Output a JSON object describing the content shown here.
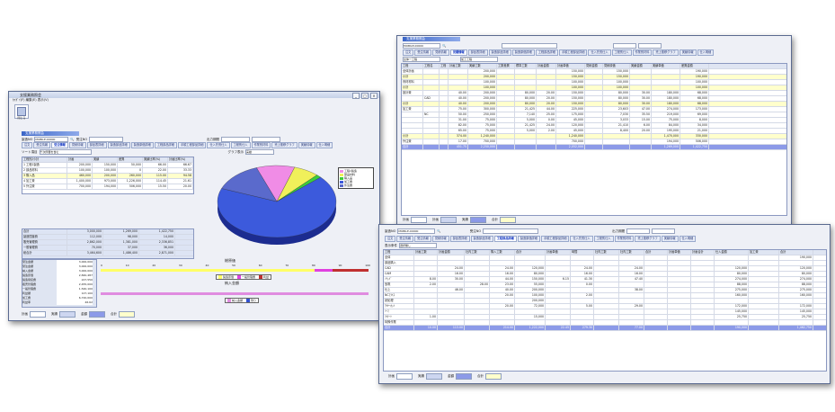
{
  "w1": {
    "title": "支援業務照会",
    "menu": [
      "ｶｲｶﾞｲ(F)",
      "編集(E)",
      "表示(V)"
    ],
    "tool_label": "閉じる",
    "header": "支援業務照会",
    "code_label": "製造NO",
    "code_value": "MOBILE-00000",
    "shop_label": "受注NO",
    "period_label": "出力期間",
    "tabs": [
      "注文",
      "受注情報",
      "受注情報",
      "見積情報",
      "部品表詳細",
      "製造部品詳細",
      "製造原価詳細",
      "工程部品詳細",
      "手順工程部品詳細",
      "仕入先別仕入",
      "工程別仕入",
      "作業別材料",
      "売上推移グラフ",
      "実績情報",
      "仕入明細"
    ],
    "filter_label": "ソート項目",
    "filter_value": "千次所要を含む",
    "sub_label": "グラフ表示",
    "sub_value": "実績",
    "table_headers": [
      "工程別/小計",
      "計画",
      "実績",
      "差異",
      "実績比率(%)",
      "計画比率(%)"
    ],
    "rows": [
      [
        "1 工程1製造",
        "200,000",
        "150,000",
        "50,000",
        "66.00",
        "66.67"
      ],
      [
        "2 部品材料",
        "100,000",
        "100,000",
        "0",
        "22.00",
        "33.33"
      ],
      [
        "3 購入品",
        "460,000",
        "200,000",
        "260,000",
        "115.00",
        "94.58"
      ],
      [
        "4 加工費",
        "1,400,000",
        "973,000",
        "1,226,000",
        "114.45",
        "21.61"
      ],
      [
        "5 外注費",
        "700,000",
        "194,000",
        "506,000",
        "15.50",
        "20.00"
      ]
    ],
    "summary_rows": [
      [
        "合計",
        "3,000,000",
        "1,269,000",
        "1,422,750"
      ],
      [
        "製造間接費",
        "112,000",
        "98,000",
        "14,000"
      ],
      [
        "販売管理費",
        "2,862,000",
        "1,381,000",
        "2,336,851"
      ],
      [
        "一般管理費",
        "70,000",
        "37,000",
        "36,000"
      ],
      [
        "総合計",
        "3,464,600",
        "1,486,400",
        "2,871,000"
      ]
    ],
    "legend": [
      "工程1製造",
      "部品材料",
      "購入品",
      "加工費",
      "外注費"
    ],
    "pie_colors": [
      "#f08ce6",
      "#f0f05a",
      "#3ccc3c",
      "#3c5adc",
      "#5a6acc"
    ],
    "pie_values": [
      150000,
      100000,
      20000,
      973000,
      194000
    ],
    "progress_labels": [
      "受注金額",
      "受注金額",
      "納入金額",
      "製造原価",
      "製造間接費",
      "販売管理費",
      "一般管理費",
      "利益額",
      "加工費",
      "利益率"
    ],
    "progress_values": [
      "3,000,000",
      "3,000,000",
      "3,000,000",
      "2,840,487",
      "227,550",
      "2,455,000",
      "1,540,100",
      "127,100",
      "6,720,000",
      "46.62"
    ],
    "chart1_title": "総原価",
    "chart1_legend": [
      "製造原価",
      "一般管理費",
      "利益"
    ],
    "chart2_title": "納入金額",
    "chart2_legend": [
      "納入金額",
      "残り"
    ],
    "axis": [
      "0",
      "10",
      "20",
      "30",
      "40",
      "50",
      "60",
      "70",
      "80",
      "90",
      "100"
    ],
    "buttons": [
      "計画",
      "実績",
      "金額",
      "合計"
    ]
  },
  "w2": {
    "title": "支援業務照会",
    "header": "支援業務照会",
    "code_value": "MOBILE-00000",
    "tabs": [
      "注文",
      "受注情報",
      "見積情報",
      "見積情報",
      "部品表詳細",
      "製造部品詳細",
      "製造原価詳細",
      "工程部品詳細",
      "手順工程部品詳細",
      "仕入先別仕入",
      "工程別仕入",
      "作業別材料",
      "売上推移グラフ",
      "実績情報",
      "仕入明細"
    ],
    "filter_value": "全体一工程",
    "filter2_value": "加工工程",
    "headers": [
      "工程",
      "工程名",
      "工程",
      "計画工数",
      "実績工数",
      "工数差異",
      "標準工数",
      "計画金額",
      "計画単価",
      "見積金額",
      "見積原価",
      "実績金額",
      "実績単価",
      "差異金額"
    ],
    "rows": [
      [
        "全体計画",
        "",
        "",
        "",
        "200,000",
        "",
        "",
        "",
        "150,000",
        "",
        "150,000",
        "",
        "",
        "190,000"
      ],
      [
        "小計",
        "",
        "",
        "",
        "200,000",
        "",
        "",
        "",
        "150,000",
        "",
        "150,000",
        "",
        "",
        "190,000"
      ],
      [
        "資材材料",
        "",
        "",
        "",
        "100,000",
        "",
        "",
        "",
        "100,000",
        "",
        "100,000",
        "",
        "",
        "100,000"
      ],
      [
        "小計",
        "",
        "",
        "",
        "100,000",
        "",
        "",
        "",
        "100,000",
        "",
        "100,000",
        "",
        "",
        "100,000"
      ],
      [
        "設計費",
        "",
        "",
        "40.00",
        "200,000",
        "",
        "80,000",
        "20.00",
        "150,000",
        "",
        "80,000",
        "30.00",
        "180,000",
        "68,000"
      ],
      [
        "",
        "CAD",
        "",
        "40.00",
        "200,000",
        "",
        "80,000",
        "20.00",
        "150,000",
        "",
        "80,000",
        "30.00",
        "180,000",
        "68,000"
      ],
      [
        "小計",
        "",
        "",
        "40.00",
        "200,000",
        "",
        "80,000",
        "20.00",
        "150,000",
        "",
        "80,000",
        "30.00",
        "180,000",
        "68,000"
      ],
      [
        "加工費",
        "",
        "",
        "75.00",
        "300,000",
        "",
        "21,425",
        "44.00",
        "225,000",
        "",
        "23,603",
        "47.00",
        "274,000",
        "173,000"
      ],
      [
        "",
        "NC",
        "",
        "50.00",
        "250,000",
        "",
        "7,140",
        "25.00",
        "175,000",
        "",
        "7,030",
        "35.50",
        "219,000",
        "69,000"
      ],
      [
        "",
        "",
        "",
        "31.00",
        "75,000",
        "",
        "5,000",
        "0.00",
        "45,000",
        "",
        "3,033",
        "15.00",
        "75,000",
        "8,000"
      ],
      [
        "",
        "",
        "",
        "82.00",
        "75,000",
        "",
        "21,425",
        "24.00",
        "120,000",
        "",
        "21,410",
        "6.00",
        "84,000",
        "34,000"
      ],
      [
        "",
        "",
        "",
        "65.00",
        "75,000",
        "",
        "5,000",
        "2.00",
        "45,000",
        "",
        "8,400",
        "20.00",
        "195,000",
        "21,000"
      ],
      [
        "小計",
        "",
        "",
        "374.00",
        "1,240,000",
        "",
        "",
        "",
        "1,240,000",
        "",
        "",
        "",
        "1,470,000",
        "330,000"
      ],
      [
        "外注費",
        "",
        "",
        "17.00",
        "700,000",
        "",
        "",
        "",
        "700,000",
        "",
        "",
        "",
        "194,000",
        "506,000"
      ],
      [
        "合計",
        "",
        "",
        "451.75",
        "2,250,000",
        "",
        "",
        "",
        "2,052,000",
        "",
        "",
        "",
        "1,269,000",
        "1,422,750"
      ]
    ],
    "buttons": [
      "計画",
      "計画",
      "実績",
      "合計"
    ]
  },
  "w3": {
    "header_code": "製造NO",
    "code_value": "MOBILE-00000",
    "shop_label": "受注NO",
    "period_label": "出力期間",
    "tabs": [
      "注文",
      "受注情報",
      "受注情報",
      "見積情報",
      "部品表詳細",
      "製造部品詳細",
      "工程部品詳細",
      "製造原価詳細",
      "手順工程部品詳細",
      "仕入先別仕入",
      "工程別仕入",
      "作業別材料",
      "売上推移グラフ",
      "実績情報",
      "仕入明細"
    ],
    "filter_label": "表示条件",
    "filter_value": "選択無し",
    "headers": [
      "工程",
      "計画工数",
      "計画金額",
      "社内工数",
      "購入工数",
      "合計",
      "計画単価",
      "時間",
      "社内工数",
      "社内工数",
      "合計",
      "計画単価",
      "計画合計",
      "仕入金額",
      "加工費",
      "合計"
    ],
    "rows": [
      [
        "全体",
        "",
        "",
        "",
        "",
        "",
        "",
        "",
        "",
        "",
        "",
        "",
        "",
        "",
        "",
        "190,000"
      ],
      [
        "部品購入",
        "",
        "",
        "",
        "",
        "",
        "",
        "",
        "",
        "",
        "",
        "",
        "",
        "",
        "",
        ""
      ],
      [
        "CAD",
        "",
        "24.00",
        "",
        "24.00",
        "120,000",
        "",
        "24.00",
        "",
        "24.00",
        "",
        "",
        "",
        "120,000",
        "",
        "120,000"
      ],
      [
        "CAM",
        "",
        "16.00",
        "",
        "16.00",
        "80,000",
        "",
        "16.00",
        "",
        "16.00",
        "",
        "",
        "",
        "80,000",
        "",
        "80,000"
      ],
      [
        "ｿﾘｯﾄﾞ",
        "8.00",
        "30.00",
        "",
        "44.00",
        "150,000",
        "6.15",
        "41.30",
        "",
        "47.40",
        "",
        "",
        "",
        "274,000",
        "",
        "274,000"
      ],
      [
        "放電",
        "2.00",
        "",
        "28.00",
        "23.00",
        "55,000",
        "",
        "0.00",
        "",
        "",
        "",
        "",
        "",
        "88,000",
        "",
        "88,000"
      ],
      [
        "仕上",
        "",
        "46.00",
        "",
        "40.00",
        "200,000",
        "",
        "",
        "",
        "38.00",
        "",
        "",
        "",
        "275,000",
        "",
        "275,000"
      ],
      [
        "NCﾌﾗｲｽ",
        "",
        "",
        "",
        "20.00",
        "100,000",
        "",
        "2.00",
        "",
        "",
        "",
        "",
        "",
        "160,000",
        "",
        "160,000"
      ],
      [
        "熱処理",
        "",
        "",
        "",
        "",
        "200,000",
        "",
        "",
        "",
        "",
        "",
        "",
        "",
        "",
        "",
        ""
      ],
      [
        "ﾜｲﾔｰｶｯﾄ",
        "",
        "",
        "",
        "20.00",
        "72,000",
        "",
        "5.00",
        "",
        "29.00",
        "",
        "",
        "",
        "172,000",
        "",
        "172,000"
      ],
      [
        "ﾘｰﾏ",
        "",
        "",
        "",
        "",
        "",
        "",
        "",
        "",
        "",
        "",
        "",
        "",
        "145,000",
        "",
        "145,000"
      ],
      [
        "ﾗｲﾅｰﾄ",
        "1.00",
        "",
        "",
        "",
        "15,000",
        "",
        "",
        "",
        "",
        "",
        "",
        "",
        "25,750",
        "",
        "25,750"
      ],
      [
        "特殊作業",
        "",
        "",
        "",
        "",
        "",
        "",
        "",
        "",
        "",
        "",
        "",
        "",
        "",
        "",
        ""
      ],
      [
        "合計",
        "10.00",
        "113.00",
        "",
        "214.00",
        "1,222,000",
        "22.45",
        "279.30",
        "",
        "77.00",
        "",
        "",
        "",
        "190,000",
        "",
        "1,462,750"
      ]
    ],
    "buttons": [
      "計画",
      "実績",
      "金額",
      "合計"
    ]
  }
}
